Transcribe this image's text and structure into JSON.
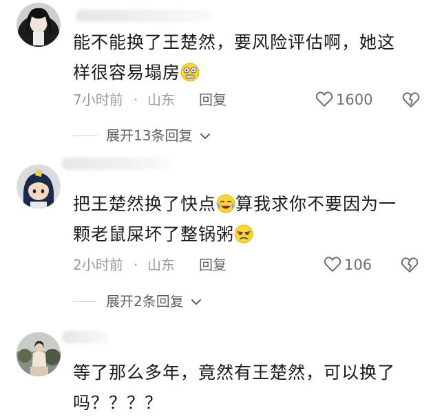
{
  "comments": [
    {
      "text_line1": "能不能换了王楚然，要风险评估啊，她这",
      "text_line2": "样很容易塌房",
      "emoji": "anxious-face",
      "time": "7小时前",
      "dot": "·",
      "location": "山东",
      "reply_label": "回复",
      "likes": "1600",
      "expand_label": "展开13条回复"
    },
    {
      "text_line1a": "把王楚然换了快点",
      "emoji1": "crying-face",
      "text_line1b": "算我求你不要因为一",
      "text_line2": "颗老鼠屎坏了整锅粥",
      "emoji2": "unamused-face",
      "time": "2小时前",
      "dot": "·",
      "location": "山东",
      "reply_label": "回复",
      "likes": "106",
      "expand_label": "展开2条回复"
    },
    {
      "text_line1": "等了那么多年，竟然有王楚然，可以换了",
      "text_line2": "吗？？？？"
    }
  ],
  "icons": {
    "like": "heart-outline-icon",
    "dislike": "broken-heart-icon",
    "chevron": "chevron-down-icon"
  },
  "colors": {
    "text": "#1a1a1a",
    "meta": "#9a9a9a",
    "expand": "#5f5f5f"
  }
}
